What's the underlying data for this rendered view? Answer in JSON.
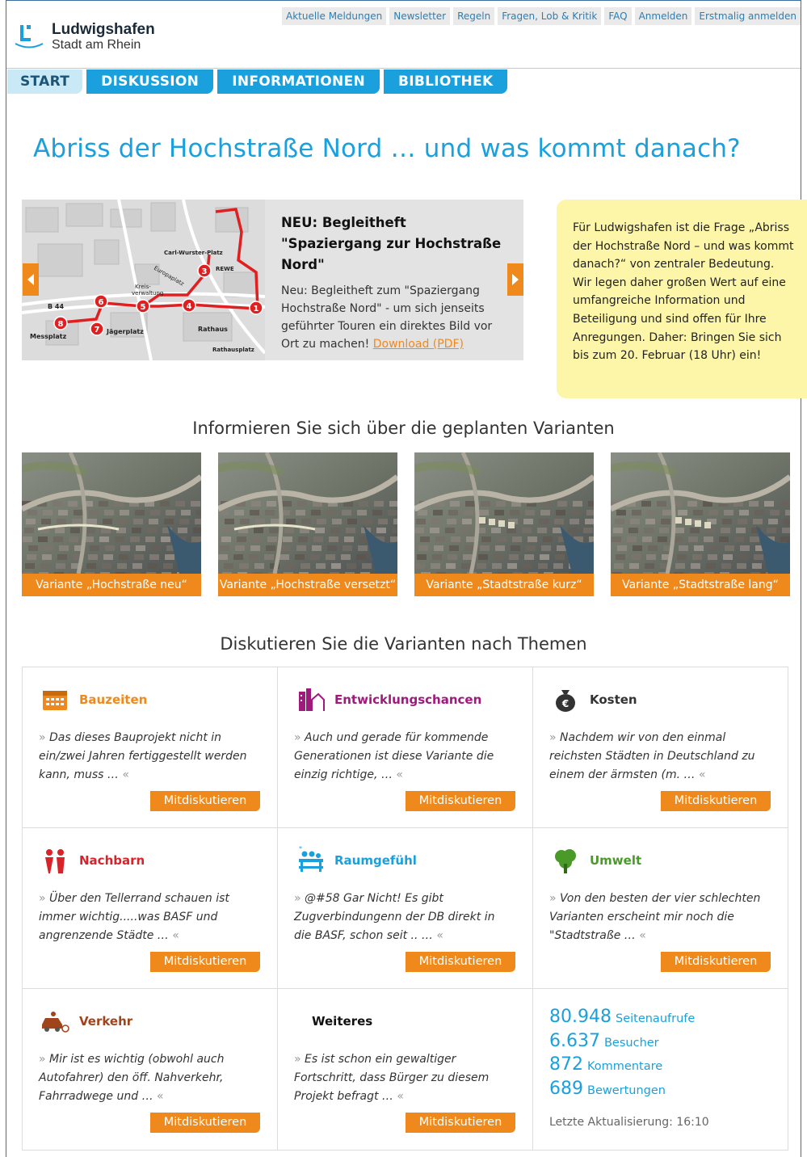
{
  "header": {
    "logo_line1": "Ludwigshafen",
    "logo_line2": "Stadt am Rhein",
    "top_links": [
      "Aktuelle Meldungen",
      "Newsletter",
      "Regeln",
      "Fragen, Lob & Kritik",
      "FAQ",
      "Anmelden",
      "Erstmalig anmelden"
    ]
  },
  "nav": {
    "tabs": [
      "START",
      "DISKUSSION",
      "INFORMATIONEN",
      "BIBLIOTHEK"
    ],
    "active": "START"
  },
  "page_title": "Abriss der Hochstraße Nord … und was kommt danach?",
  "slider": {
    "heading": "NEU: Begleitheft \"Spaziergang zur Hochstraße Nord\"",
    "body": "Neu: Begleitheft zum \"Spaziergang Hochstraße Nord\" - um sich jenseits geführter Touren ein direktes Bild vor Ort zu machen! ",
    "link": "Download (PDF)",
    "map_labels": [
      "Carl-Wurster-Platz",
      "REWE",
      "Kreis-verwaltung",
      "Europaplatz",
      "B 44",
      "Jägerplatz",
      "Rathaus",
      "Messplatz",
      "Rathausplatz"
    ],
    "map_stops": [
      "1",
      "3",
      "4",
      "5",
      "6",
      "7",
      "8"
    ]
  },
  "note": {
    "text": "Für Ludwigshafen ist die Frage „Abriss der Hochstraße Nord – und was kommt danach?“ von zentraler Bedeutung. Wir legen daher großen Wert auf eine umfangreiche Information und Beteiligung und sind offen für Ihre Anregungen. Daher: Bringen Sie sich bis zum 20. Februar (18 Uhr) ein!"
  },
  "variants_heading": "Informieren Sie sich über die geplanten Varianten",
  "variants": [
    {
      "caption": "Variante „Hochstraße neu“"
    },
    {
      "caption": "Variante „Hochstraße versetzt“"
    },
    {
      "caption": "Variante „Stadtstraße kurz“"
    },
    {
      "caption": "Variante „Stadtstraße lang“"
    }
  ],
  "topics_heading": "Diskutieren Sie die Varianten nach Themen",
  "topics": [
    {
      "label": "Bauzeiten",
      "color": "#f0891b",
      "icon": "calendar-icon",
      "quote": "Das dieses Bauprojekt nicht in ein/zwei Jahren fertiggestellt werden kann, muss …",
      "button": "Mitdiskutieren"
    },
    {
      "label": "Entwicklungschancen",
      "color": "#a0197d",
      "icon": "city-development-icon",
      "quote": "Auch und gerade für kommende Generationen ist diese Variante die einzig richtige, …",
      "button": "Mitdiskutieren"
    },
    {
      "label": "Kosten",
      "color": "#333333",
      "icon": "money-bag-icon",
      "quote": "Nachdem wir von den einmal reichsten Städten in Deutschland zu einem der ärmsten (m. …",
      "button": "Mitdiskutieren"
    },
    {
      "label": "Nachbarn",
      "color": "#d8232a",
      "icon": "neighbors-icon",
      "quote": "Über den Tellerrand schauen ist immer wichtig.....was BASF und angrenzende Städte …",
      "button": "Mitdiskutieren"
    },
    {
      "label": "Raumgefühl",
      "color": "#1aa0dc",
      "icon": "people-bench-icon",
      "quote": "@#58 Gar Nicht! Es gibt Zugverbindungenn der DB direkt in die BASF, schon seit .. …",
      "button": "Mitdiskutieren"
    },
    {
      "label": "Umwelt",
      "color": "#4a9a2a",
      "icon": "tree-icon",
      "quote": "Von den besten der vier schlechten Varianten erscheint mir noch die \"Stadtstraße …",
      "button": "Mitdiskutieren"
    },
    {
      "label": "Verkehr",
      "color": "#a0441b",
      "icon": "car-bike-icon",
      "quote": "Mir ist es wichtig (obwohl auch Autofahrer) den öff. Nahverkehr, Fahrradwege und …",
      "button": "Mitdiskutieren"
    },
    {
      "label": "Weiteres",
      "color": "#111111",
      "icon": "",
      "quote": "Es ist schon ein gewaltiger Fortschritt, dass Bürger zu diesem Projekt befragt …",
      "button": "Mitdiskutieren"
    }
  ],
  "stats": [
    {
      "num": "80.948",
      "label": "Seitenaufrufe"
    },
    {
      "num": "6.637",
      "label": "Besucher"
    },
    {
      "num": "872",
      "label": "Kommentare"
    },
    {
      "num": "689",
      "label": "Bewertungen"
    }
  ],
  "updated": "Letzte Aktualisierung: 16:10",
  "quote_open": "»",
  "quote_close": "«",
  "colors": {
    "accent_blue": "#1aa0dc",
    "accent_orange": "#f0891b",
    "note_yellow": "#fdf6a8"
  }
}
